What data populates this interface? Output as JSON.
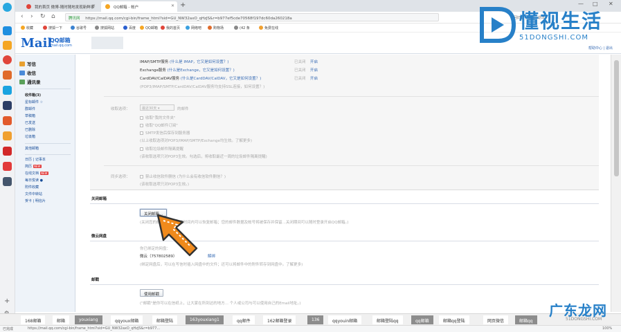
{
  "browser": {
    "tabs": [
      {
        "title": "我的首页 微博-随时随地发现新鲜事",
        "active": false
      },
      {
        "title": "QQ邮箱 - 帐户",
        "active": true
      }
    ],
    "window_controls": {
      "minimize": "—",
      "maximize": "□",
      "close": "✕"
    },
    "secure_label": "腾讯网",
    "url": "https://mail.qq.com/cgi-bin/frame_html?sid=GU_NW32axO_qHzJS&r=b977ef5cde70568f197dc60da260218a",
    "right_link": "换回旧版 | 设置 | 退出",
    "bookmarks": [
      "收藏",
      "搜狐一下",
      "谷歌号",
      "搜狐网站",
      "百度",
      "QQ邮箱",
      "我的首页",
      "网络吧",
      "购物场",
      "(42 条",
      "免费在线"
    ]
  },
  "mail": {
    "logo_main": "Mail",
    "logo_cn": "QQ邮箱",
    "logo_sub": "mail.qq.com",
    "header_links": "帮助中心 | 退出",
    "sidebar": {
      "actions": [
        "写信",
        "收信",
        "通讯录"
      ],
      "folders": [
        {
          "label": "收件箱(3)"
        },
        {
          "label": "星标邮件 ☆"
        },
        {
          "label": "群邮件"
        },
        {
          "label": "草稿箱"
        },
        {
          "label": "已发送"
        },
        {
          "label": "已删除"
        },
        {
          "label": "垃圾箱"
        }
      ],
      "other_mailbox": "其他邮箱",
      "apps": [
        {
          "label": "日历 | 记事本"
        },
        {
          "label": "简历",
          "badge": "NEW"
        },
        {
          "label": "在线文档",
          "badge": "NEW"
        },
        {
          "label": "每日悦读 ●"
        },
        {
          "label": "附件收藏"
        },
        {
          "label": "文件中转站"
        },
        {
          "label": "贺卡 | 明信片"
        }
      ]
    },
    "settings": {
      "imap_smtp": "IMAP/SMTP服务",
      "imap_smtp_hint": "(什么是 IMAP，它又是如何设置？)",
      "exchange": "Exchange服务",
      "exchange_hint": "(什么是Exchange，它又是如何设置？)",
      "carddav": "CardDAV/CalDAV服务",
      "carddav_hint": "(什么是CardDAV/CalDAV，它又是如何设置？)",
      "protocol_note": "(POP3/IMAP/SMTP/CardDAV/CalDAV服务均支持SSL连接，如何设置？)",
      "status_opened": "已关闭",
      "toggle_open": "开启",
      "recv_label": "收取选项：",
      "recv_select": "最近30天",
      "recv_unit": "的邮件",
      "recv_options": [
        "收取\"我的文件夹\"",
        "收取\"QQ邮件订阅\"",
        "SMTP发信后保存到服务器"
      ],
      "recv_note": "(以上收取选项对POP3/IMAP/SMTP/Exchange均生效。了解更多)",
      "recv_option_extra": "收取垃圾邮件隔离提醒",
      "recv_note2": "(该收取选项只对POP3生效。勾选后，将收取最近一周的垃圾邮件隔离提醒)",
      "sync_label": "同步选项：",
      "sync_option": "禁止收信软件删信",
      "sync_option_hint": "(为什么会有收信软件删信？)",
      "sync_note": "(该收取选项只对POP3生效。)",
      "close_section": "关闭邮箱",
      "close_button": "关闭邮箱...",
      "close_note": "(关闭您的邮箱后，在一定时间内可以恢复邮箱；您的邮件数据及帐号将被保存并保留...关闭期间可以随时登录开启QQ邮箱。)",
      "disk_section": "微云网盘",
      "disk_line1": "你已绑定的网盘：",
      "disk_account": "微云（757802589）",
      "disk_unbind": "解绑",
      "disk_note": "(绑定网盘后，可以在写信时插入网盘中的文件；还可以将邮件中的附件转存到网盘中。了解更多)",
      "postcard_section": "邮戳",
      "postcard_button": "使用邮戳",
      "postcard_note": "(\"邮戳\"是你可以在信纸上，让大家在所到达的地方... 个人或公司与可以使用自己的Email地址。)"
    }
  },
  "search_tags": [
    "168邮箱",
    "邮箱",
    "youxiang",
    "qqyoux邮箱",
    "邮箱登陆",
    "163youxiang1",
    "qq邮件",
    "162邮箱登录",
    "136",
    "qqyouin邮箱",
    "邮箱登陆qq",
    "qq邮箱",
    "邮箱qq登陆",
    "网页微信",
    "邮箱qq"
  ],
  "status_bar": {
    "left": "https://mail.qq.com/cgi-bin/frame_html?sid=GU_NW32axO_qHzJS&r=b977...",
    "left_prefix": "已完成",
    "right": "100%"
  },
  "watermark": {
    "top_cn": "懂视生活",
    "top_en": "51DONGSHI.COM",
    "bottom_cn": "广东龙网",
    "bottom_en": "51DONGSHI.COM"
  }
}
